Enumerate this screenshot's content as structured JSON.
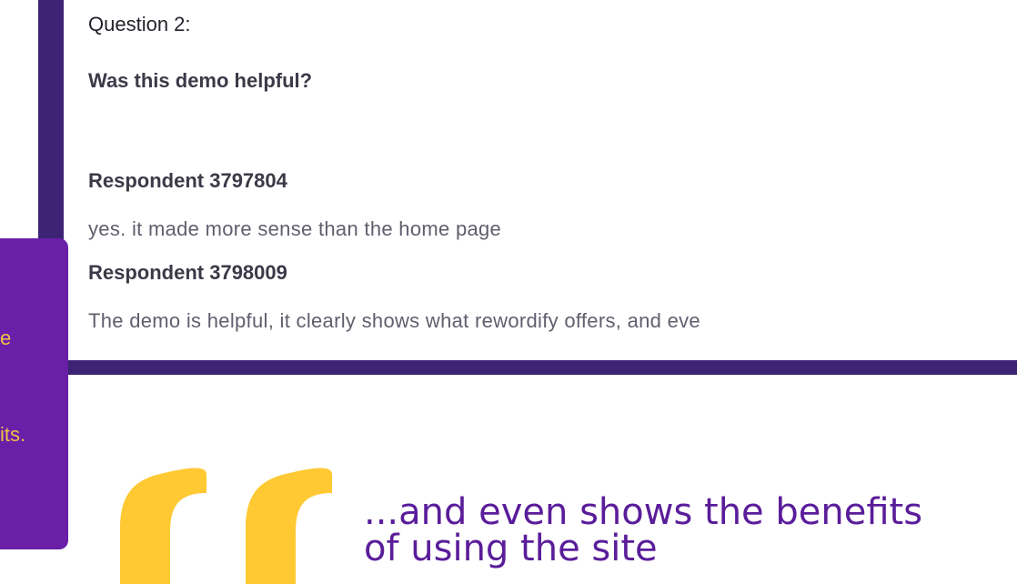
{
  "survey": {
    "question_number": "Question 2:",
    "question_text": "Was this demo helpful?",
    "responses": [
      {
        "respondent": "Respondent 3797804",
        "answer": "yes. it made more sense than the home page"
      },
      {
        "respondent": "Respondent 3798009",
        "answer": "The demo is helpful, it clearly shows what rewordify offers, and eve"
      }
    ]
  },
  "side_panel": {
    "fragment_1": "e",
    "fragment_2": "its."
  },
  "quote": {
    "line_1": "...and even shows the benefits",
    "line_2": " of using the site"
  },
  "colors": {
    "frame": "#3d2374",
    "side_panel": "#6a1fa8",
    "side_text": "#f2c04a",
    "quote_mark": "#ffc933",
    "quote_text": "#5a1d9a"
  }
}
